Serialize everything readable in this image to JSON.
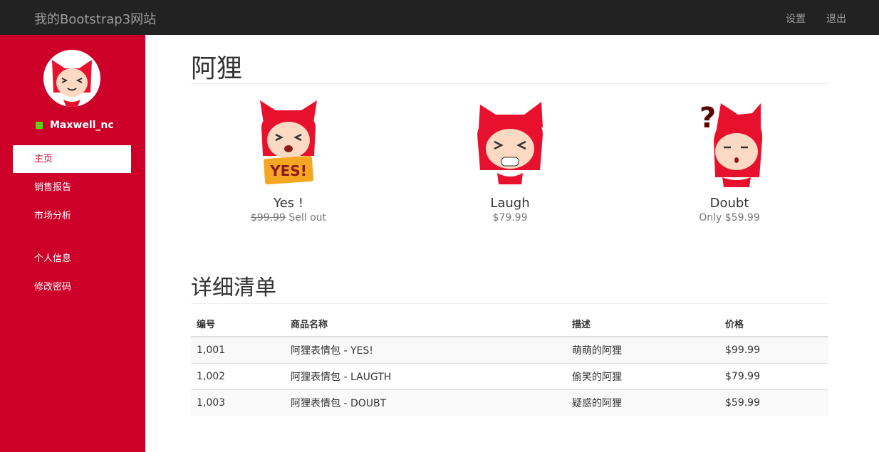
{
  "navbar": {
    "brand": "我的Bootstrap3网站",
    "links": [
      "设置",
      "退出"
    ]
  },
  "sidebar": {
    "username": "Maxwell_nc",
    "status_color": "#5cd11a",
    "items": [
      "主页",
      "销售报告",
      "市场分析",
      "个人信息",
      "修改密码"
    ],
    "active_index": 0
  },
  "main": {
    "title": "阿狸",
    "products": [
      {
        "name": "Yes !",
        "old_price": "$99.99",
        "price_text": "Sell out"
      },
      {
        "name": "Laugh",
        "price_text": "$79.99"
      },
      {
        "name": "Doubt",
        "price_text": "Only $59.99"
      }
    ],
    "table_title": "详细清单",
    "table": {
      "headers": [
        "编号",
        "商品名称",
        "描述",
        "价格"
      ],
      "rows": [
        [
          "1,001",
          "阿狸表情包 - YES!",
          "萌萌的阿狸",
          "$99.99"
        ],
        [
          "1,002",
          "阿狸表情包 - LAUGTH",
          "偷笑的阿狸",
          "$79.99"
        ],
        [
          "1,003",
          "阿狸表情包 - DOUBT",
          "疑惑的阿狸",
          "$59.99"
        ]
      ]
    }
  },
  "colors": {
    "navbar_bg": "#222222",
    "sidebar_bg": "#cc0028",
    "accent_red": "#e8112d"
  }
}
